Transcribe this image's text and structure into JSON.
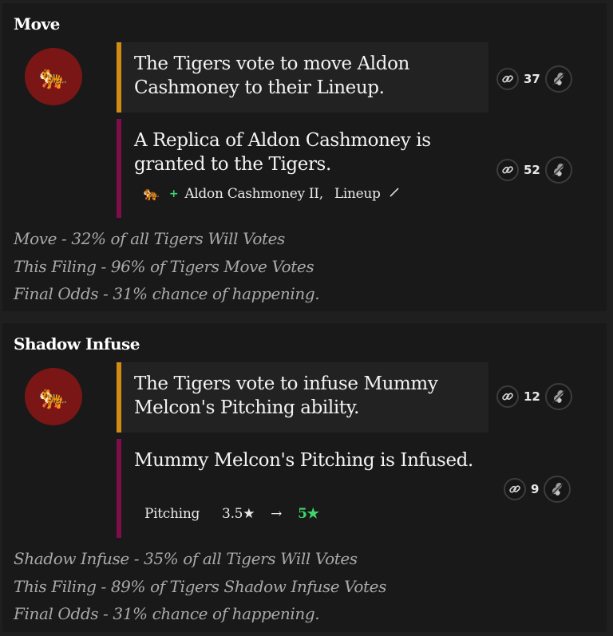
{
  "proposals": [
    {
      "title": "Move",
      "team_emoji": "🐅",
      "proposal_text": "The Tigers vote to move Aldon Cashmoney to their Lineup.",
      "proposal_votes": "37",
      "result_text": "A Replica of Aldon Cashmoney is granted to the Tigers.",
      "result_votes": "52",
      "result_meta": {
        "plus": "+",
        "player": "Aldon Cashmoney II,",
        "location": "Lineup"
      },
      "stats": [
        "Move - 32% of all Tigers Will Votes",
        "This Filing - 96% of Tigers Move Votes",
        "Final Odds - 31% chance of happening."
      ]
    },
    {
      "title": "Shadow Infuse",
      "team_emoji": "🐅",
      "proposal_text": "The Tigers vote to infuse Mummy Melcon's Pitching ability.",
      "proposal_votes": "12",
      "result_text": "Mummy Melcon's Pitching is Infused.",
      "result_votes": "9",
      "result_meta": {
        "attribute": "Pitching",
        "old_value": "3.5",
        "arrow": "→",
        "new_value": "5"
      },
      "stats": [
        "Shadow Infuse - 35% of all Tigers Will Votes",
        "This Filing - 89% of Tigers Shadow Infuse Votes",
        "Final Odds - 31% chance of happening."
      ]
    }
  ],
  "colors": {
    "proposal_border": "#d28a14",
    "result_border": "#7e0d4a",
    "badge_bg": "#7a1616",
    "accent_green": "#3dd66b"
  },
  "icons": [
    "link-icon",
    "vote-token-icon",
    "tiger-icon",
    "pencil-icon",
    "star-icon"
  ]
}
